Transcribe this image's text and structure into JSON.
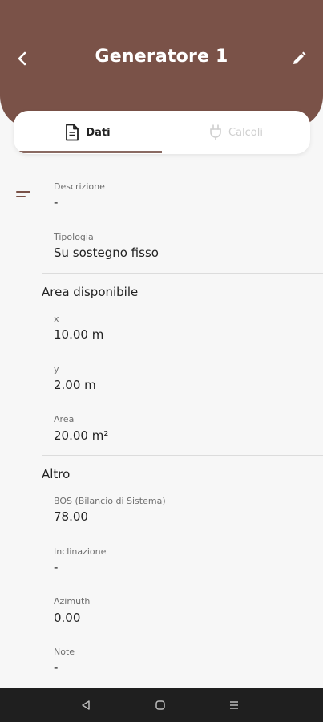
{
  "header": {
    "title": "Generatore 1",
    "back_icon": "chevron-left-icon",
    "edit_icon": "pencil-icon",
    "background": "#7a5248"
  },
  "tabs": [
    {
      "label": "Dati",
      "icon": "document-icon",
      "active": true
    },
    {
      "label": "Calcoli",
      "icon": "plug-icon",
      "active": false
    }
  ],
  "fields": {
    "descrizione": {
      "label": "Descrizione",
      "value": "-"
    },
    "tipologia": {
      "label": "Tipologia",
      "value": "Su sostegno fisso"
    }
  },
  "area": {
    "title": "Area disponibile",
    "x": {
      "label": "x",
      "value": "10.00 m"
    },
    "y": {
      "label": "y",
      "value": "2.00 m"
    },
    "area": {
      "label": "Area",
      "value": "20.00 m²"
    }
  },
  "altro": {
    "title": "Altro",
    "bos": {
      "label": "BOS (Bilancio di Sistema)",
      "value": "78.00"
    },
    "inclinazione": {
      "label": "Inclinazione",
      "value": "-"
    },
    "azimuth": {
      "label": "Azimuth",
      "value": "0.00"
    },
    "note": {
      "label": "Note",
      "value": "-"
    }
  },
  "navbar": {
    "icons": [
      "back-triangle-icon",
      "home-square-icon",
      "recents-menu-icon"
    ]
  }
}
